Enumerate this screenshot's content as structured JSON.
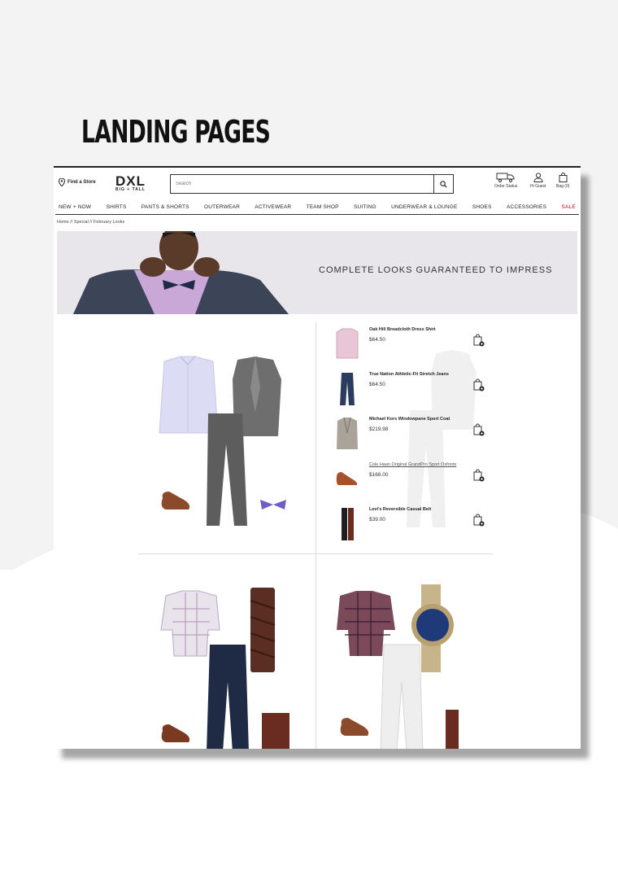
{
  "page": {
    "title": "LANDING PAGES"
  },
  "header": {
    "find_store": "Find a Store",
    "logo_main": "DXL",
    "logo_sub": "BIG + TALL",
    "search_placeholder": "Search",
    "order_status": "Order Status",
    "hi_guest": "Hi Guest",
    "bag": "Bag (0)"
  },
  "nav": {
    "items": [
      "NEW + NOW",
      "SHIRTS",
      "PANTS & SHORTS",
      "OUTERWEAR",
      "ACTIVEWEAR",
      "TEAM SHOP",
      "SUITING",
      "UNDERWEAR & LOUNGE",
      "SHOES",
      "ACCESSORIES",
      "SALE"
    ]
  },
  "breadcrumb": "Home // Special // February Looks",
  "hero": {
    "text": "COMPLETE LOOKS GUARANTEED TO IMPRESS"
  },
  "products": [
    {
      "name": "Oak Hill Breadcloth Dress Shirt",
      "price": "$64.50"
    },
    {
      "name": "True Nation Athletic-Fit Stretch Jeans",
      "price": "$64.50"
    },
    {
      "name": "Michael Kors Windowpane Sport Coat",
      "price": "$219.98"
    },
    {
      "name": "Cole Haan Original GrandPro Sport Oxfords",
      "price": "$168.00"
    },
    {
      "name": "Levi's Reversible Casual Belt",
      "price": "$39.00"
    }
  ],
  "colors": {
    "sale": "#d0021b",
    "navy": "#1f2b45",
    "background": "#f2f3f2"
  }
}
